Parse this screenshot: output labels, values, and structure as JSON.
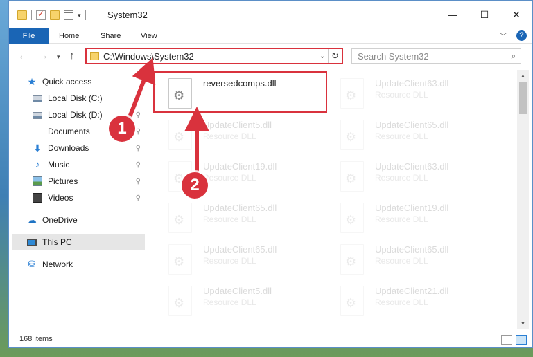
{
  "window": {
    "title": "System32",
    "caption": {
      "minimize": "—",
      "maximize": "☐",
      "close": "✕"
    }
  },
  "ribbon": {
    "tabs": [
      "File",
      "Home",
      "Share",
      "View"
    ]
  },
  "address": {
    "path": "C:\\Windows\\System32",
    "search_placeholder": "Search System32"
  },
  "nav": {
    "items": [
      {
        "label": "Quick access",
        "icon": "star-icon",
        "pinned": false
      },
      {
        "label": "Local Disk (C:)",
        "icon": "drive-icon",
        "pinned": true
      },
      {
        "label": "Local Disk (D:)",
        "icon": "drive-icon",
        "pinned": true
      },
      {
        "label": "Documents",
        "icon": "documents-icon",
        "pinned": true
      },
      {
        "label": "Downloads",
        "icon": "download-icon",
        "pinned": true
      },
      {
        "label": "Music",
        "icon": "music-icon",
        "pinned": true
      },
      {
        "label": "Pictures",
        "icon": "pictures-icon",
        "pinned": true
      },
      {
        "label": "Videos",
        "icon": "videos-icon",
        "pinned": true
      },
      {
        "label": "OneDrive",
        "icon": "cloud-icon",
        "pinned": false
      },
      {
        "label": "This PC",
        "icon": "computer-icon",
        "pinned": false,
        "selected": true
      },
      {
        "label": "Network",
        "icon": "network-icon",
        "pinned": false
      }
    ]
  },
  "files": [
    {
      "name": "reversedcomps.dll",
      "type": "",
      "highlighted": true
    },
    {
      "name": "UpdateClient63.dll",
      "type": "Resource DLL"
    },
    {
      "name": "UpdateClient5.dll",
      "type": "Resource DLL"
    },
    {
      "name": "UpdateClient65.dll",
      "type": "Resource DLL"
    },
    {
      "name": "UpdateClient19.dll",
      "type": "Resource DLL"
    },
    {
      "name": "UpdateClient63.dll",
      "type": "Resource DLL"
    },
    {
      "name": "UpdateClient65.dll",
      "type": "Resource DLL"
    },
    {
      "name": "UpdateClient19.dll",
      "type": "Resource DLL"
    },
    {
      "name": "UpdateClient65.dll",
      "type": "Resource DLL"
    },
    {
      "name": "UpdateClient65.dll",
      "type": "Resource DLL"
    },
    {
      "name": "UpdateClient5.dll",
      "type": "Resource DLL"
    },
    {
      "name": "UpdateClient21.dll",
      "type": "Resource DLL"
    }
  ],
  "status": {
    "item_count": "168 items"
  },
  "annotations": {
    "step1": "1",
    "step2": "2",
    "accent": "#d9323d"
  }
}
